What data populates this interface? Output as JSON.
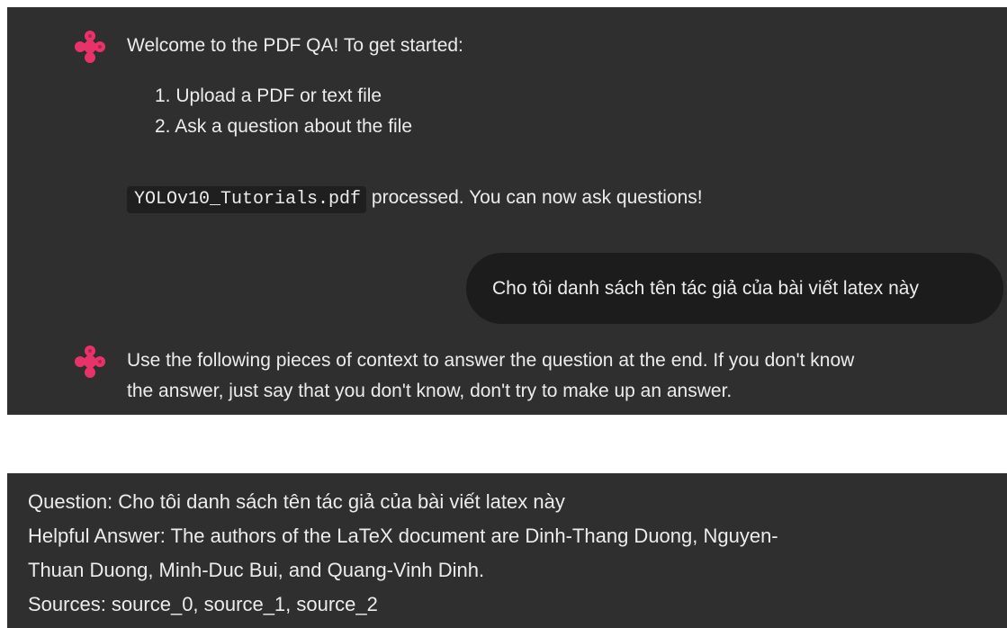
{
  "colors": {
    "panel_bg": "#2f2f2f",
    "user_bubble_bg": "#1c1c1c",
    "text": "#ececec",
    "accent": "#e8336a"
  },
  "assistant_icon": "pink-diamond-logo-icon",
  "messages": {
    "welcome": {
      "intro": "Welcome to the PDF QA! To get started:",
      "steps": [
        "1. Upload a PDF or text file",
        "2. Ask a question about the file"
      ]
    },
    "processed": {
      "file_name": "YOLOv10_Tutorials.pdf",
      "suffix": "processed. You can now ask questions!"
    },
    "user_question": "Cho tôi danh sách tên tác giả của bài viết latex này",
    "assistant_reply": {
      "line1": "Use the following pieces of context to answer the question at the end. If you don't know",
      "line2": "the answer, just say that you don't know, don't try to make up an answer."
    }
  },
  "answer_block": {
    "question": "Question: Cho tôi danh sách tên tác giả của bài viết latex này",
    "answer_line1": "Helpful Answer: The authors of the LaTeX document are Dinh-Thang Duong, Nguyen-",
    "answer_line2": "Thuan Duong, Minh-Duc Bui, and Quang-Vinh Dinh.",
    "sources": "Sources: source_0, source_1, source_2"
  }
}
